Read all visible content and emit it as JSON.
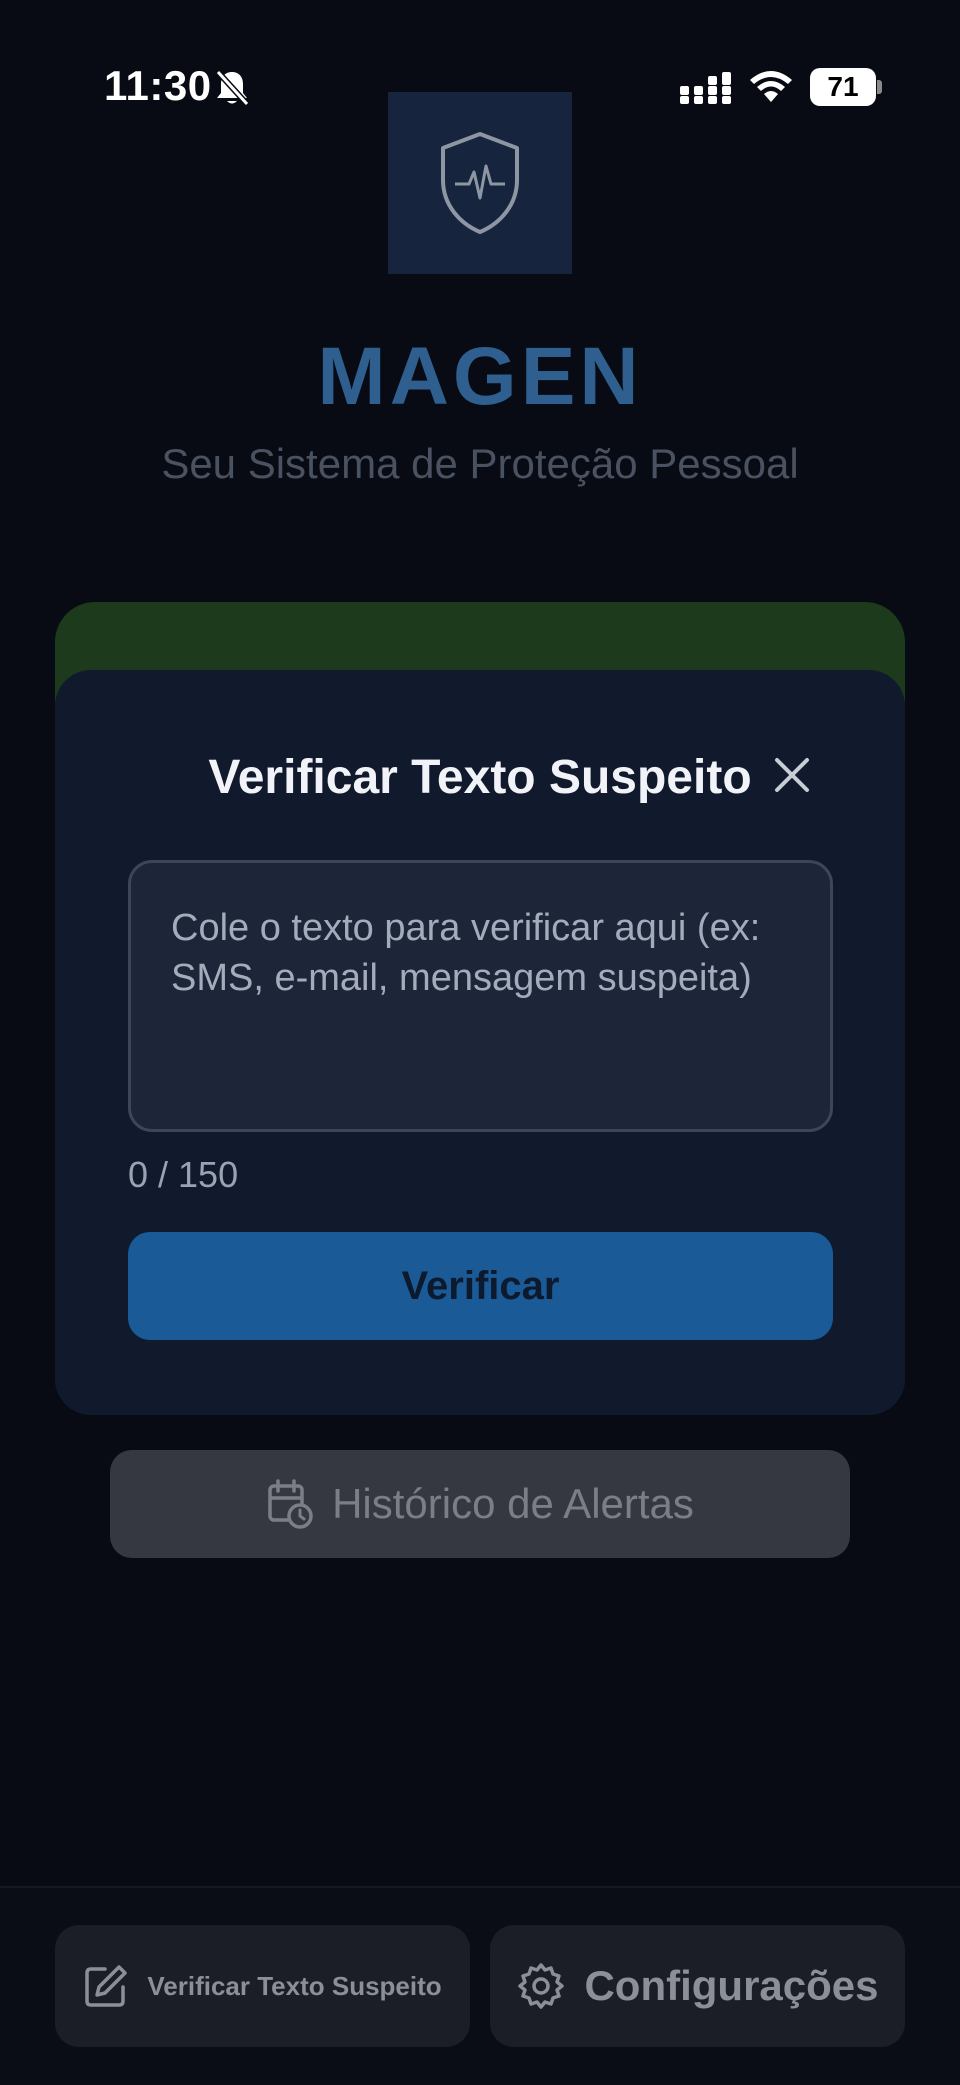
{
  "status_bar": {
    "time": "11:30",
    "battery": "71",
    "icons": [
      "bell-off-icon",
      "cellular-signal-icon",
      "wifi-icon",
      "battery-icon"
    ]
  },
  "header": {
    "logo_icon": "shield-heartbeat-icon",
    "title": "MAGEN",
    "subtitle": "Seu Sistema de Proteção Pessoal"
  },
  "modal": {
    "title": "Verificar Texto Suspeito",
    "close_icon": "close-icon",
    "textarea_placeholder": "Cole o texto para verificar aqui (ex: SMS, e-mail, mensagem suspeita)",
    "textarea_value": "",
    "counter": "0 / 150",
    "verify_label": "Verificar"
  },
  "history_button": {
    "icon": "calendar-clock-icon",
    "label": "Histórico de Alertas"
  },
  "bottom_nav": {
    "items": [
      {
        "icon": "edit-icon",
        "label": "Verificar Texto Suspeito"
      },
      {
        "icon": "gear-icon",
        "label": "Configurações"
      }
    ]
  },
  "colors": {
    "background": "#080b14",
    "title": "#2e5f8f",
    "modal": "#111a2c",
    "accent_button": "#1a5a97",
    "green_card": "#1d3a1c"
  }
}
